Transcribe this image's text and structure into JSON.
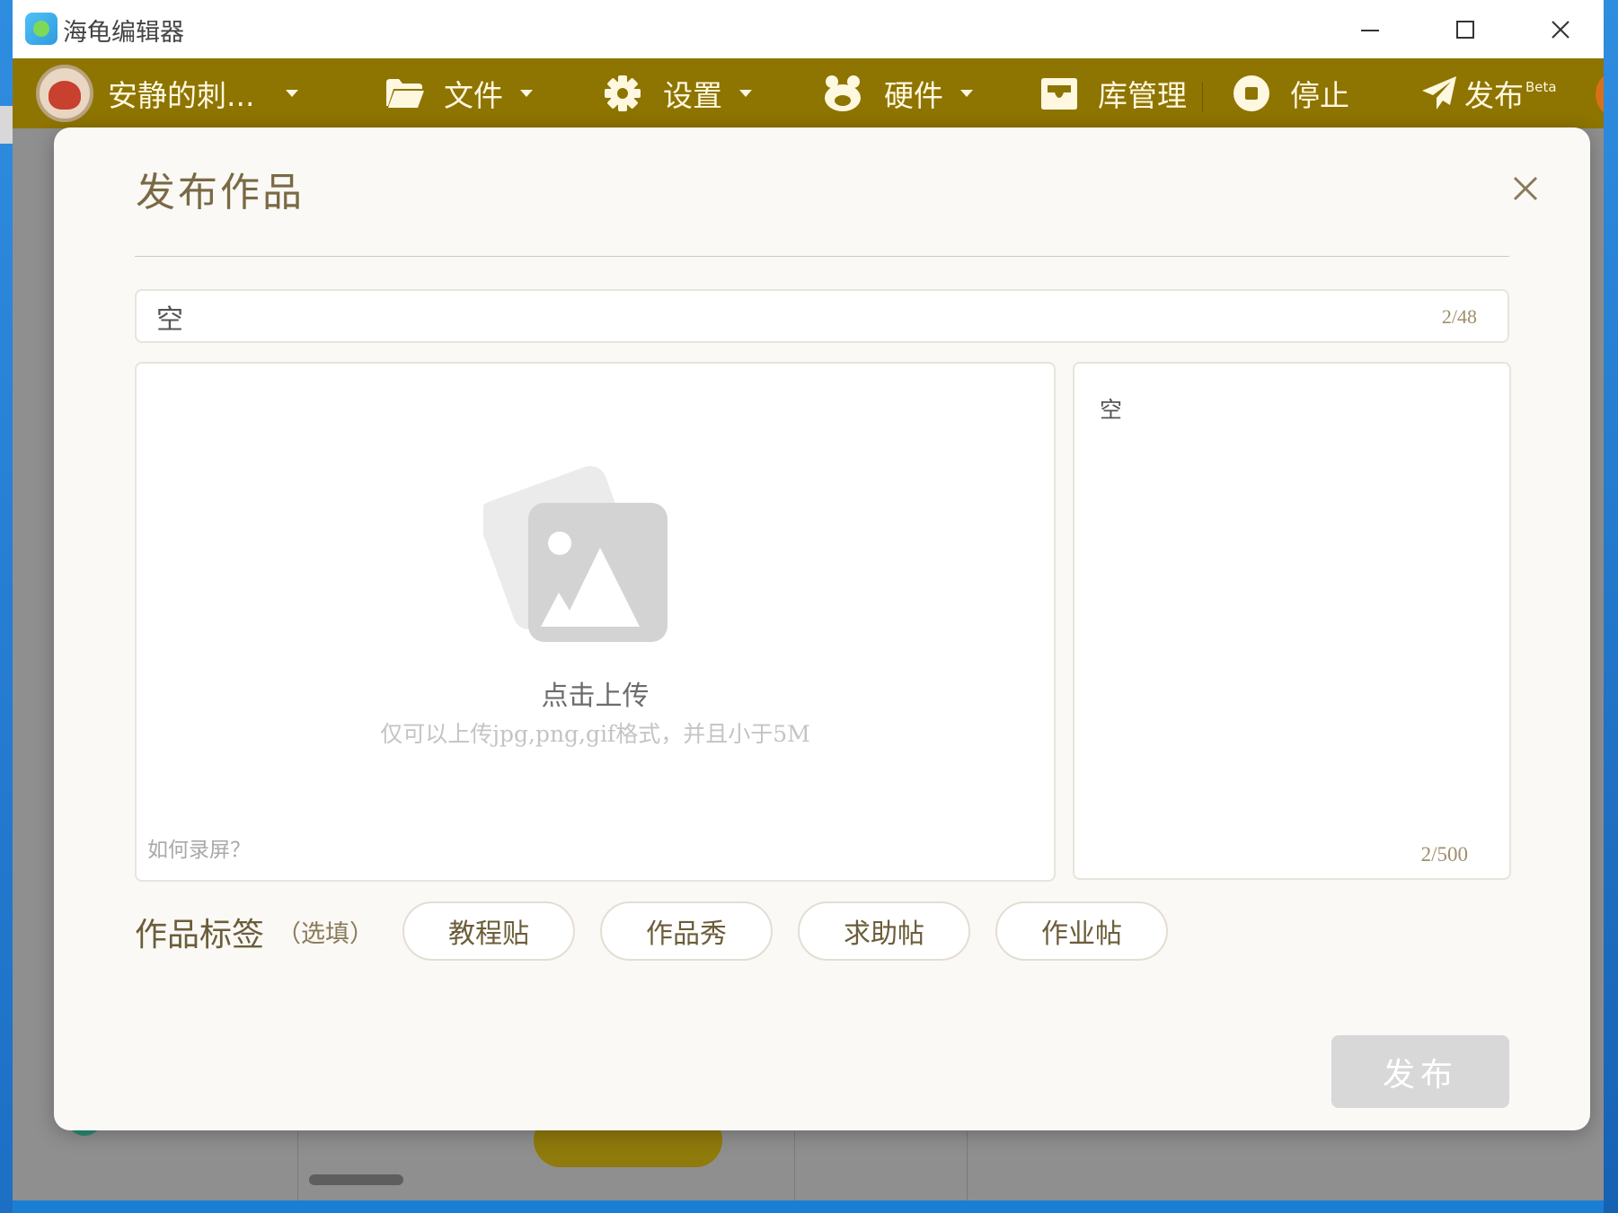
{
  "app": {
    "title": "海龟编辑器"
  },
  "toolbar": {
    "user_name": "安静的刺...",
    "file_label": "文件",
    "settings_label": "设置",
    "hardware_label": "硬件",
    "library_label": "库管理",
    "stop_label": "停止",
    "publish_label": "发布",
    "beta_label": "Beta"
  },
  "dialog": {
    "title": "发布作品",
    "title_input": {
      "value": "空",
      "counter": "2/48"
    },
    "upload": {
      "label": "点击上传",
      "hint": "仅可以上传jpg,png,gif格式，并且小于5M",
      "record_link": "如何录屏？"
    },
    "description": {
      "value": "空",
      "counter": "2/500"
    },
    "tags": {
      "label": "作品标签",
      "optional": "（选填）",
      "items": [
        "教程贴",
        "作品秀",
        "求助帖",
        "作业帖"
      ]
    },
    "publish_button": "发布"
  },
  "colors": {
    "toolbar_bg": "#8e7400",
    "dialog_bg": "#faf9f6",
    "accent_text": "#7a6a44",
    "disabled_button": "#d8d8d8"
  },
  "icons": [
    "app-logo-icon",
    "minimize-icon",
    "maximize-icon",
    "close-icon",
    "folder-icon",
    "gear-icon",
    "hardware-icon",
    "library-box-icon",
    "stop-icon",
    "paper-plane-icon",
    "image-placeholder-icon",
    "chevron-down-icon"
  ]
}
